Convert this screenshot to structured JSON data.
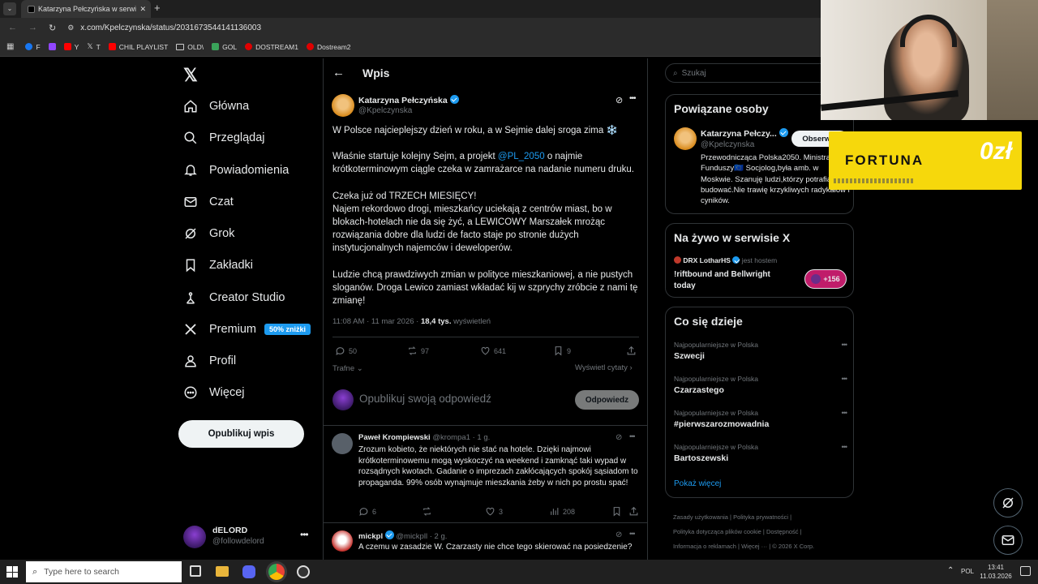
{
  "browser": {
    "tab_title": "Katarzyna Pełczyńska w serwisie X",
    "url": "x.com/Kpelczynska/status/2031673544141136003",
    "bookmarks": [
      {
        "label": "F",
        "color": "#1877f2"
      },
      {
        "label": "",
        "color": "#9146ff"
      },
      {
        "label": "Y",
        "color": "#ff0000"
      },
      {
        "label": "T",
        "color": "#ffffff"
      },
      {
        "label": "CHIL PLAYLIST",
        "color": "#ff0000"
      },
      {
        "label": "OLD\\",
        "color": "#aaaaaa"
      },
      {
        "label": "GOL",
        "color": "#3aa35a"
      },
      {
        "label": "DOSTREAM1",
        "color": "#e00000"
      },
      {
        "label": "Dostream2",
        "color": "#e00000"
      }
    ]
  },
  "nav": {
    "items": [
      {
        "label": "Główna",
        "icon": "home-icon"
      },
      {
        "label": "Przeglądaj",
        "icon": "search-icon"
      },
      {
        "label": "Powiadomienia",
        "icon": "bell-icon"
      },
      {
        "label": "Czat",
        "icon": "mail-icon"
      },
      {
        "label": "Grok",
        "icon": "grok-icon"
      },
      {
        "label": "Zakładki",
        "icon": "bookmark-icon"
      },
      {
        "label": "Creator Studio",
        "icon": "creator-icon"
      },
      {
        "label": "Premium",
        "icon": "x-icon"
      },
      {
        "label": "Profil",
        "icon": "person-icon"
      },
      {
        "label": "Więcej",
        "icon": "more-icon"
      }
    ],
    "premium_badge": "50% zniżki",
    "publish_label": "Opublikuj wpis",
    "account_name": "dELORD",
    "account_handle": "@followdelord"
  },
  "main": {
    "header_title": "Wpis",
    "tweet": {
      "author": "Katarzyna Pełczyńska",
      "handle": "@Kpelczynska",
      "p1": "W Polsce najcieplejszy dzień w roku, a w Sejmie dalej sroga zima ❄️",
      "p2_a": "Właśnie startuje kolejny Sejm, a projekt ",
      "p2_mention": "@PL_2050",
      "p2_b": " o najmie krótkoterminowym ciągle czeka w zamrażarce na nadanie numeru druku.",
      "p3_a": "Czeka już od TRZECH MIESIĘCY!",
      "p3_b": "Najem rekordowo drogi, mieszkańcy uciekają z centrów miast, bo w blokach-hotelach nie da się żyć, a LEWICOWY Marszałek mrożąc rozwiązania dobre dla ludzi de facto staje po stronie dużych instytucjonalnych najemców i deweloperów.",
      "p4": "Ludzie chcą prawdziwych zmian w polityce mieszkaniowej, a nie pustych sloganów. Droga Lewico zamiast wkładać kij w szprychy zróbcie z nami tę zmianę!",
      "timestamp": "11:08 AM · 11 mar 2026 · ",
      "views_count": "18,4 tys.",
      "views_label": " wyświetleń",
      "replies": "50",
      "reposts": "97",
      "likes": "641",
      "bookmarks": "9",
      "sort_label": "Trafne",
      "quotes_label": "Wyświetl cytaty"
    },
    "reply_placeholder": "Opublikuj swoją odpowiedź",
    "reply_button": "Odpowiedz",
    "replies": [
      {
        "author": "Paweł Krompiewski",
        "handle": "@krompa1",
        "time": "· 1 g.",
        "text": "Zrozum kobieto, że niektórych nie stać na hotele. Dzięki najmowi krótkoterminowemu mogą wyskoczyć na weekend i zamknąć taki wypad w rozsądnych kwotach. Gadanie o imprezach zakłócających spokój sąsiadom to propaganda. 99% osób wynajmuje mieszkania żeby w nich po prostu spać!",
        "replies": "6",
        "reposts": "",
        "likes": "3",
        "views": "208"
      },
      {
        "author": "mickpl",
        "handle": "@mickpll",
        "time": "· 2 g.",
        "text": "A czemu w zasadzie W. Czarzasty nie chce tego skierować na posiedzenie?"
      }
    ]
  },
  "right": {
    "search_placeholder": "Szukaj",
    "related_title": "Powiązane osoby",
    "related_name": "Katarzyna Pełczy...",
    "related_handle": "@Kpelczynska",
    "follow_label": "Obserwuj",
    "related_bio": "Przewodnicząca Polska2050. Ministra Funduszy🇪🇺 Socjolog,była amb. w Moskwie. Szanuję ludzi,którzy potrafią budować.Nie trawię krzykliwych radykałów i cyników.",
    "live_title": "Na żywo w serwisie X",
    "live_host": "DRX LotharHS",
    "live_host_suffix": "jest hostem",
    "live_text": "!riftbound and Bellwright today",
    "live_count": "+156",
    "trends_title": "Co się dzieje",
    "trends": [
      {
        "category": "Najpopularniejsze w Polska",
        "name": "Szwecji"
      },
      {
        "category": "Najpopularniejsze w Polska",
        "name": "Czarzastego"
      },
      {
        "category": "Najpopularniejsze w Polska",
        "name": "#pierwszarozmowadnia"
      },
      {
        "category": "Najpopularniejsze w Polska",
        "name": "Bartoszewski"
      }
    ],
    "show_more": "Pokaż więcej",
    "footer": {
      "l1": "Zasady użytkowania",
      "l2": "Polityka prywatności",
      "l3": "Polityka dotycząca plików cookie",
      "l4": "Dostępność",
      "l5": "Informacja o reklamach",
      "l6": "Więcej ···",
      "l7": "© 2026 X Corp."
    }
  },
  "overlay": {
    "sponsor": "FORTUNA",
    "sponsor_tail": "0zł"
  },
  "taskbar": {
    "search_placeholder": "Type here to search",
    "lang": "POL",
    "time": "13:41",
    "date": "11.03.2026"
  }
}
